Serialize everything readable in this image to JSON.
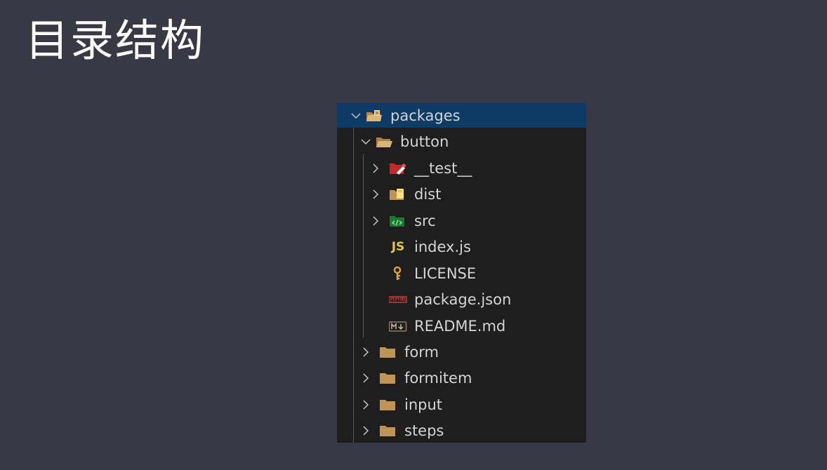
{
  "slide": {
    "title": "目录结构"
  },
  "explorer": {
    "root": {
      "label": "packages",
      "icon": "folder-packages-open-icon",
      "expanded": true
    },
    "button": {
      "label": "button",
      "icon": "folder-open-icon",
      "expanded": true
    },
    "button_children": [
      {
        "label": "__test__",
        "icon": "folder-test-icon",
        "kind": "folder",
        "expanded": false
      },
      {
        "label": "dist",
        "icon": "folder-dist-icon",
        "kind": "folder",
        "expanded": false
      },
      {
        "label": "src",
        "icon": "folder-src-icon",
        "kind": "folder",
        "expanded": false
      },
      {
        "label": "index.js",
        "icon": "javascript-file-icon",
        "kind": "file",
        "badge": "JS"
      },
      {
        "label": "LICENSE",
        "icon": "license-key-icon",
        "kind": "file"
      },
      {
        "label": "package.json",
        "icon": "npm-icon",
        "kind": "file"
      },
      {
        "label": "README.md",
        "icon": "markdown-icon",
        "kind": "file"
      }
    ],
    "siblings": [
      {
        "label": "form",
        "icon": "folder-icon",
        "expanded": false
      },
      {
        "label": "formitem",
        "icon": "folder-icon",
        "expanded": false
      },
      {
        "label": "input",
        "icon": "folder-icon",
        "expanded": false
      },
      {
        "label": "steps",
        "icon": "folder-icon",
        "expanded": false
      }
    ]
  },
  "colors": {
    "background": "#393845",
    "panel": "#1e1e1e",
    "selection": "#0e3a66",
    "folder": "#c09553",
    "text": "#d4d4d4"
  }
}
